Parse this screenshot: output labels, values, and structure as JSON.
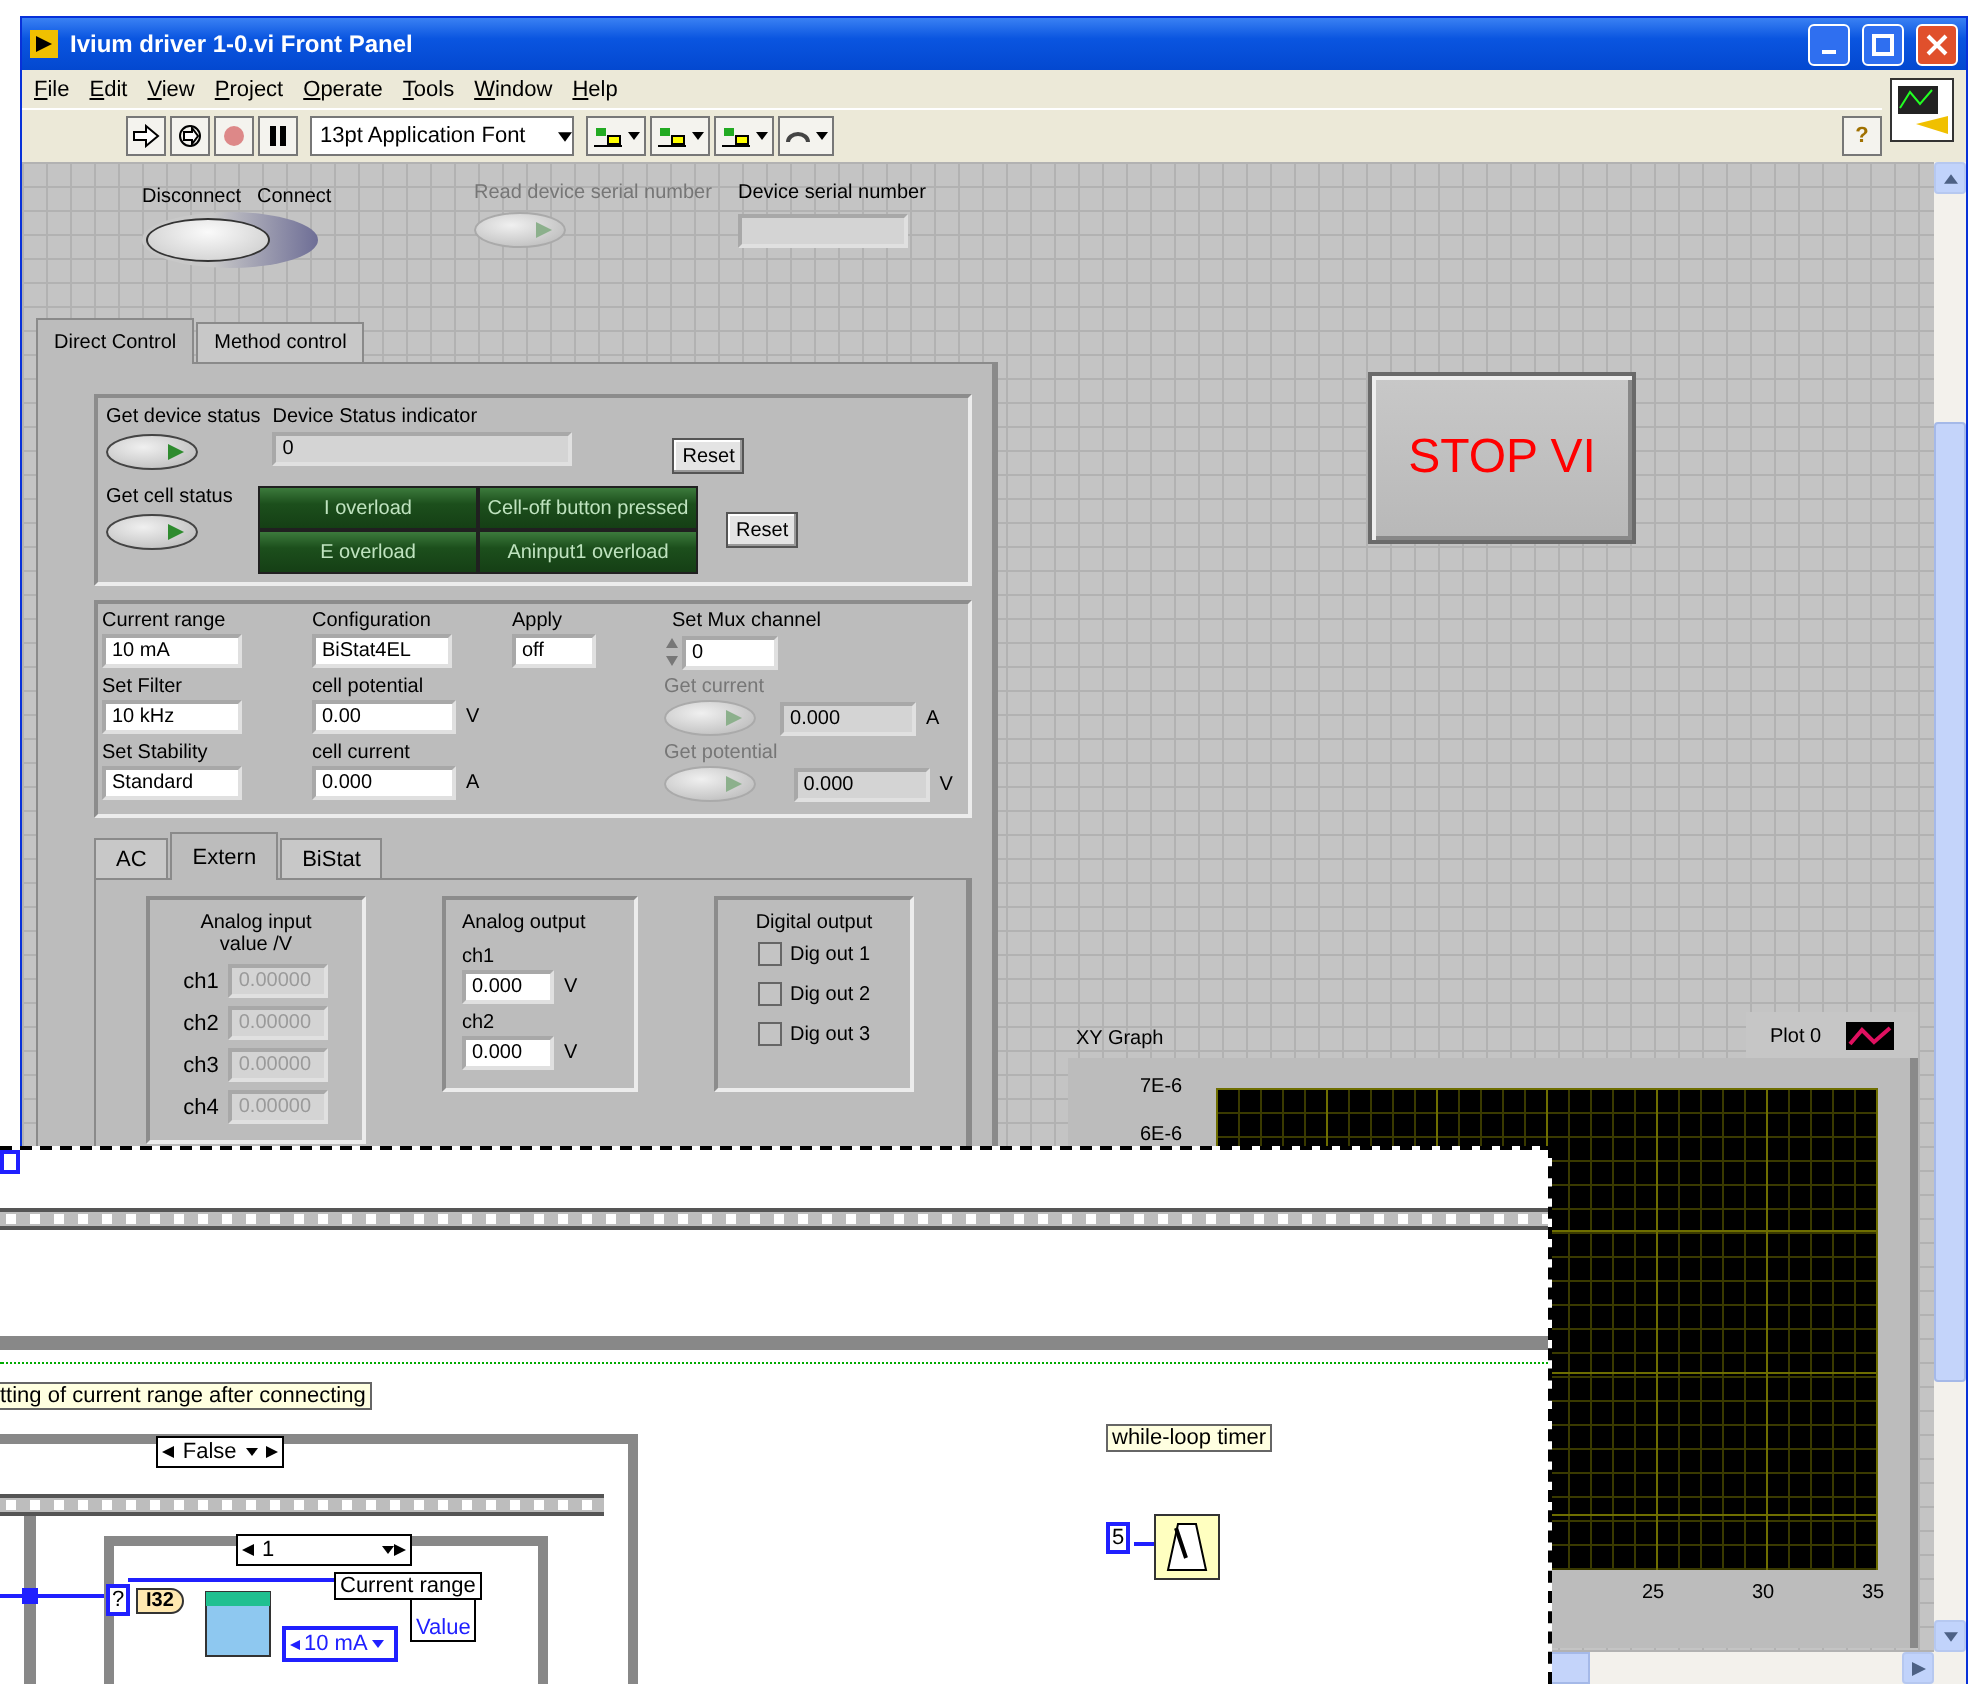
{
  "window": {
    "title": "Ivium driver 1-0.vi Front Panel"
  },
  "menu": [
    "File",
    "Edit",
    "View",
    "Project",
    "Operate",
    "Tools",
    "Window",
    "Help"
  ],
  "toolbar": {
    "font": "13pt Application Font",
    "help": "?"
  },
  "connect_switch": {
    "off_label": "Disconnect",
    "on_label": "Connect",
    "on": false
  },
  "read_serial": {
    "label": "Read device serial number",
    "disabled": true
  },
  "serial": {
    "label": "Device serial number"
  },
  "main_tabs": [
    {
      "label": "Direct Control",
      "selected": true
    },
    {
      "label": "Method control",
      "selected": false
    }
  ],
  "status_group": {
    "device_button": "Get device status",
    "indicator_label": "Device Status indicator",
    "indicator_value": "0",
    "reset_1": "Reset",
    "cell_button": "Get cell status",
    "reset_2": "Reset",
    "leds": [
      {
        "label": "I overload",
        "on": false
      },
      {
        "label": "Cell-off button pressed",
        "on": false
      },
      {
        "label": "E overload",
        "on": false
      },
      {
        "label": "Aninput1 overload",
        "on": false
      }
    ]
  },
  "settings": {
    "current_range": {
      "label": "Current range",
      "value": "10 mA"
    },
    "configuration": {
      "label": "Configuration",
      "value": "BiStat4EL"
    },
    "apply": {
      "label": "Apply",
      "value": "off"
    },
    "mux": {
      "label": "Set Mux channel",
      "value": "0"
    },
    "filter": {
      "label": "Set Filter",
      "value": "10 kHz"
    },
    "stability": {
      "label": "Set Stability",
      "value": "Standard"
    },
    "cell_potential": {
      "label": "cell potential",
      "value": "0.00",
      "unit": "V"
    },
    "cell_current": {
      "label": "cell current",
      "value": "0.000",
      "unit": "A"
    },
    "get_current": {
      "label": "Get current",
      "disabled": true,
      "value": "0.000",
      "unit": "A"
    },
    "get_potential": {
      "label": "Get potential",
      "disabled": true,
      "value": "0.000",
      "unit": "V"
    }
  },
  "sub_tabs": [
    {
      "label": "AC",
      "selected": false
    },
    {
      "label": "Extern",
      "selected": true
    },
    {
      "label": "BiStat",
      "selected": false
    }
  ],
  "analog_input": {
    "title": "Analog input value /V",
    "disabled": true,
    "channels": [
      {
        "label": "ch1",
        "value": "0.00000"
      },
      {
        "label": "ch2",
        "value": "0.00000"
      },
      {
        "label": "ch3",
        "value": "0.00000"
      },
      {
        "label": "ch4",
        "value": "0.00000"
      }
    ]
  },
  "analog_output": {
    "title": "Analog output",
    "channels": [
      {
        "label": "ch1",
        "value": "0.000",
        "unit": "V"
      },
      {
        "label": "ch2",
        "value": "0.000",
        "unit": "V"
      }
    ]
  },
  "digital_output": {
    "title": "Digital output",
    "items": [
      {
        "label": "Dig out 1",
        "checked": false
      },
      {
        "label": "Dig out 2",
        "checked": false
      },
      {
        "label": "Dig out 3",
        "checked": false
      }
    ]
  },
  "stop_button": "STOP VI",
  "graph": {
    "label": "XY Graph",
    "legend": "Plot 0",
    "y_ticks": [
      "7E-6",
      "6E-6"
    ],
    "x_ticks": [
      "25",
      "30",
      "35"
    ]
  },
  "diagram": {
    "comment": "tting of current range after connecting",
    "case_selector": "False",
    "inner_selector": "1",
    "terminal": "?",
    "type_label": "I32",
    "node_label": "Current range",
    "enum_value": "10 mA",
    "property": "Value",
    "timer_label": "while-loop timer",
    "timer_constant": "5"
  }
}
